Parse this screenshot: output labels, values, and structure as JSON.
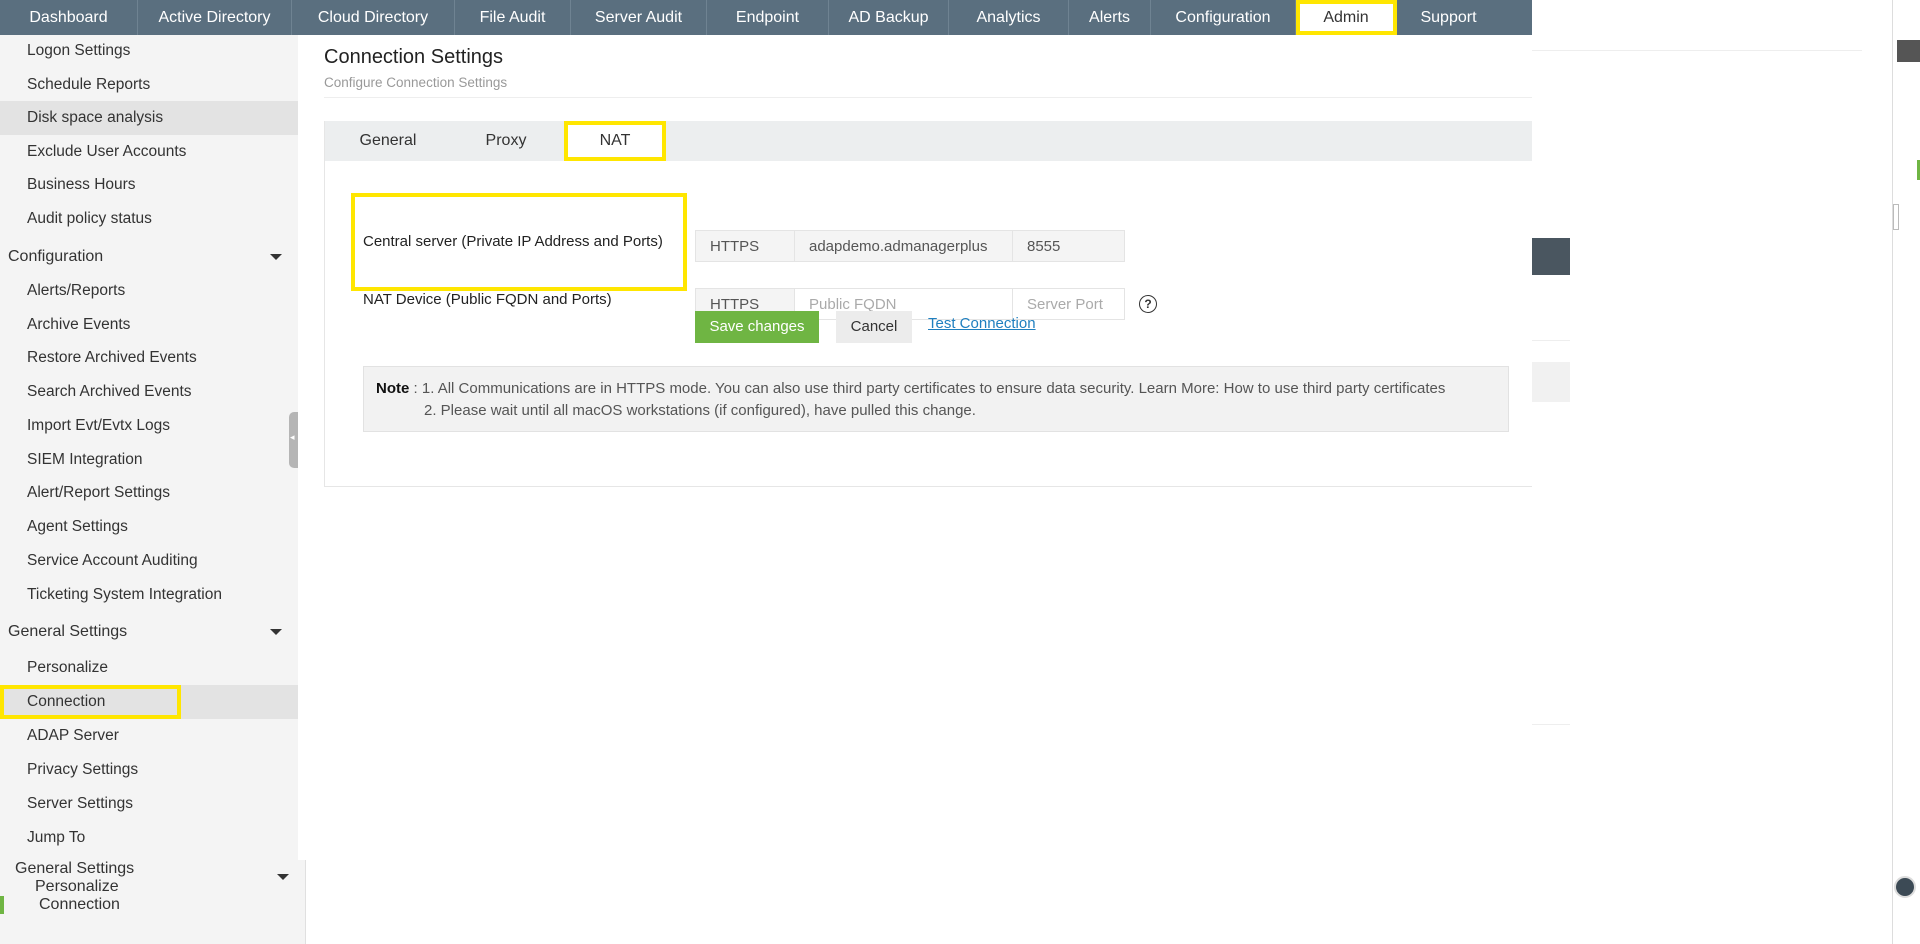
{
  "topnav": {
    "tabs": [
      {
        "label": "Dashboard"
      },
      {
        "label": "Active Directory"
      },
      {
        "label": "Cloud Directory"
      },
      {
        "label": "File Audit"
      },
      {
        "label": "Server Audit"
      },
      {
        "label": "Endpoint"
      },
      {
        "label": "AD Backup"
      },
      {
        "label": "Analytics"
      },
      {
        "label": "Alerts"
      },
      {
        "label": "Configuration"
      },
      {
        "label": "Admin"
      },
      {
        "label": "Support"
      }
    ],
    "active_tab": "Admin"
  },
  "sidebar": {
    "top_items": [
      {
        "label": "Logon Settings"
      },
      {
        "label": "Schedule Reports"
      },
      {
        "label": "Disk space analysis"
      },
      {
        "label": "Exclude User Accounts"
      },
      {
        "label": "Business Hours"
      },
      {
        "label": "Audit policy status"
      }
    ],
    "configuration": {
      "heading": "Configuration",
      "items": [
        {
          "label": "Alerts/Reports"
        },
        {
          "label": "Archive Events"
        },
        {
          "label": "Restore Archived Events"
        },
        {
          "label": "Search Archived Events"
        },
        {
          "label": "Import Evt/Evtx Logs"
        },
        {
          "label": "SIEM Integration"
        },
        {
          "label": "Alert/Report Settings"
        },
        {
          "label": "Agent Settings"
        },
        {
          "label": "Service Account Auditing"
        },
        {
          "label": "Ticketing System Integration"
        }
      ]
    },
    "general_settings": {
      "heading": "General Settings",
      "items": [
        {
          "label": "Personalize"
        },
        {
          "label": "Connection"
        },
        {
          "label": "ADAP Server"
        },
        {
          "label": "Privacy Settings"
        },
        {
          "label": "Server Settings"
        },
        {
          "label": "Jump To"
        }
      ]
    },
    "duplicate_section": {
      "heading": "General Settings",
      "items": [
        {
          "label": "Personalize"
        },
        {
          "label": "Connection"
        }
      ]
    }
  },
  "main": {
    "title": "Connection Settings",
    "subtitle": "Configure Connection Settings",
    "tabs": [
      {
        "label": "General"
      },
      {
        "label": "Proxy"
      },
      {
        "label": "NAT"
      }
    ],
    "active_tab": "NAT",
    "central_server": {
      "label": "Central server (Private IP Address and Ports)",
      "protocol": "HTTPS",
      "host": "adapdemo.admanagerplus",
      "port": "8555"
    },
    "nat_device": {
      "label": "NAT Device (Public FQDN and Ports)",
      "protocol": "HTTPS",
      "fqdn_placeholder": "Public FQDN",
      "port_placeholder": "Server Port"
    },
    "help_symbol": "?",
    "buttons": {
      "save": "Save changes",
      "cancel": "Cancel",
      "test": "Test Connection"
    },
    "note": {
      "label": "Note",
      "line1": ": 1. All Communications are in HTTPS mode. You can also use third party certificates to ensure data security. Learn More: How to use third party certificates",
      "line2": "2. Please wait until all macOS workstations (if configured), have pulled this change."
    }
  },
  "colors": {
    "nav_bg": "#5a6f7f",
    "highlight": "#ffe600",
    "save_button": "#6fb543",
    "link": "#1f7fbf"
  }
}
